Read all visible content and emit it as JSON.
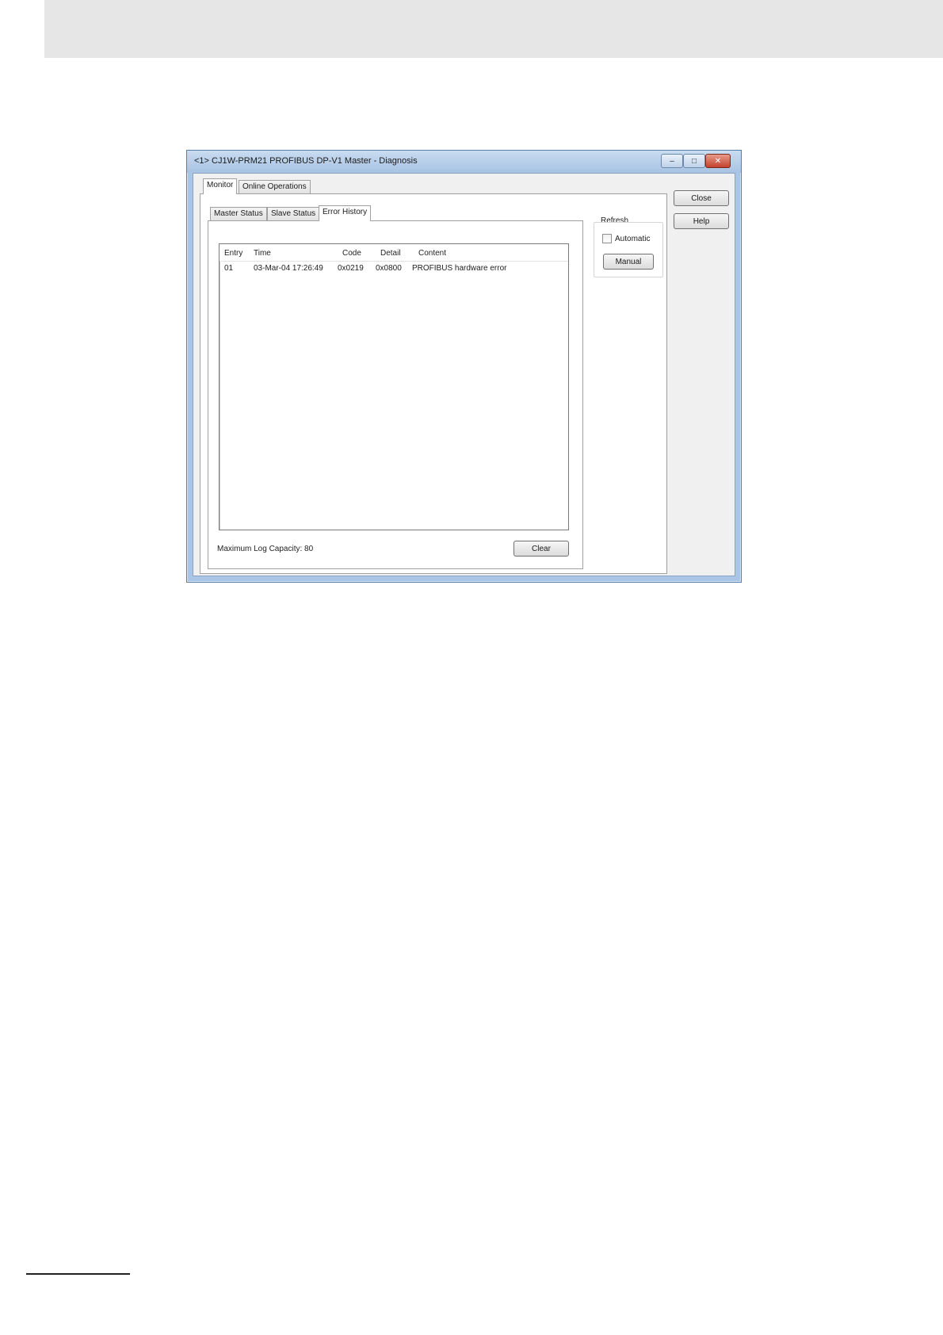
{
  "window": {
    "title": "<1> CJ1W-PRM21 PROFIBUS DP-V1 Master - Diagnosis",
    "minimize_glyph": "–",
    "maximize_glyph": "□",
    "close_glyph": "✕"
  },
  "main_tabs": [
    {
      "label": "Monitor",
      "active": true
    },
    {
      "label": "Online Operations",
      "active": false
    }
  ],
  "sub_tabs": [
    {
      "label": "Master Status",
      "active": false
    },
    {
      "label": "Slave Status",
      "active": false
    },
    {
      "label": "Error History",
      "active": true
    }
  ],
  "error_table": {
    "columns": [
      "Entry",
      "Time",
      "Code",
      "Detail",
      "Content"
    ],
    "rows": [
      [
        "01",
        "03-Mar-04 17:26:49",
        "0x0219",
        "0x0800",
        "PROFIBUS hardware error"
      ]
    ]
  },
  "max_log_capacity_label": "Maximum Log Capacity: 80",
  "clear_button": "Clear",
  "refresh": {
    "group_label": "Refresh",
    "automatic_label": "Automatic",
    "automatic_checked": false,
    "manual_button": "Manual"
  },
  "side_buttons": {
    "close": "Close",
    "help": "Help"
  }
}
